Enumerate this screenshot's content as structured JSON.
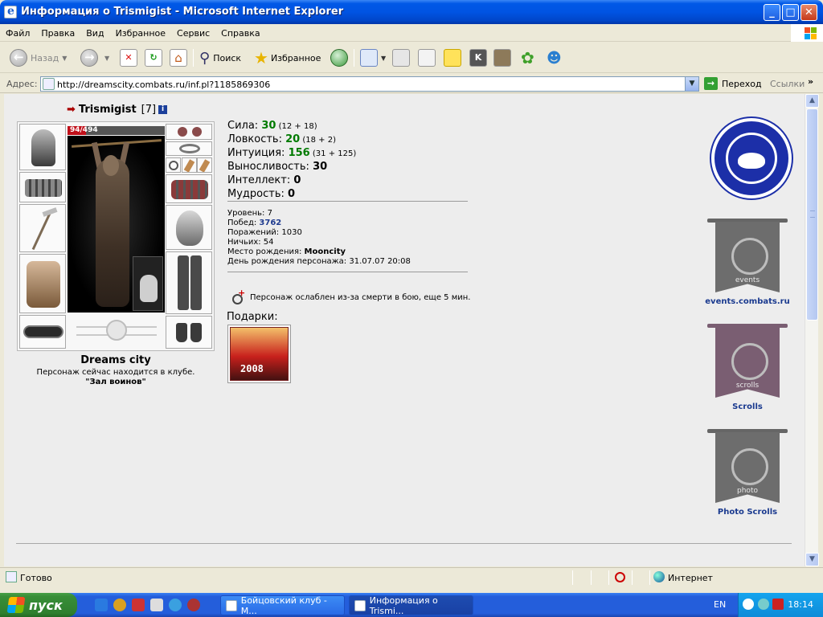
{
  "window": {
    "title": "Информация о Trismigist - Microsoft Internet Explorer",
    "minimize": "_",
    "maximize": "□",
    "close": "✕"
  },
  "menu": [
    "Файл",
    "Правка",
    "Вид",
    "Избранное",
    "Сервис",
    "Справка"
  ],
  "toolbar": {
    "back_label": "Назад",
    "search_label": "Поиск",
    "favorites_label": "Избранное"
  },
  "address": {
    "label": "Адрес:",
    "url": "http://dreamscity.combats.ru/inf.pl?1185869306",
    "go_label": "Переход",
    "links_label": "Ссылки",
    "more": "»"
  },
  "character": {
    "name": "Trismigist",
    "level_badge": "[7]",
    "info_icon": "i",
    "hp_text": "94/494",
    "hp_fraction": 0.19,
    "city": "Dreams city",
    "club_line": "Персонаж сейчас находится в клубе.",
    "club_name": "\"Зал воинов\""
  },
  "stats": [
    {
      "label": "Сила: ",
      "value": "30",
      "extra": " (12 + 18)",
      "green": true
    },
    {
      "label": "Ловкость: ",
      "value": "20",
      "extra": " (18 + 2)",
      "green": true
    },
    {
      "label": "Интуиция: ",
      "value": "156",
      "extra": " (31 + 125)",
      "green": true
    },
    {
      "label": "Выносливость: ",
      "value": "30",
      "extra": "",
      "green": false
    },
    {
      "label": "Интеллект: ",
      "value": "0",
      "extra": "",
      "green": false
    },
    {
      "label": "Мудрость: ",
      "value": "0",
      "extra": "",
      "green": false
    }
  ],
  "info": {
    "level_label": "Уровень: ",
    "level": "7",
    "wins_label": "Побед: ",
    "wins": "3762",
    "losses_label": "Поражений: ",
    "losses": "1030",
    "draws_label": "Ничьих: ",
    "draws": "54",
    "birthplace_label": "Место рождения: ",
    "birthplace": "Mooncity",
    "birthday_label": "День рождения персонажа: ",
    "birthday": "31.07.07 20:08"
  },
  "status_message": "Персонаж ослаблен из-за смерти в бою, еще 5 мин.",
  "gifts": {
    "title": "Подарки:",
    "card_year": "2008"
  },
  "sidebar_links": [
    {
      "inner": "events",
      "caption": "events.combats.ru"
    },
    {
      "inner": "scrolls",
      "caption": "Scrolls"
    },
    {
      "inner": "photo",
      "caption": "Photo Scrolls"
    }
  ],
  "statusbar": {
    "text": "Готово",
    "zone": "Интернет"
  },
  "taskbar": {
    "start_label": "пуск",
    "tasks": [
      {
        "label": "Бойцовский клуб - M..."
      },
      {
        "label": "Информация о Trismi..."
      }
    ],
    "language": "EN",
    "clock": "18:14"
  },
  "colors": {
    "stat_green": "#007a00",
    "link_blue": "#1a3a8f",
    "hp_red": "#c0101a"
  }
}
